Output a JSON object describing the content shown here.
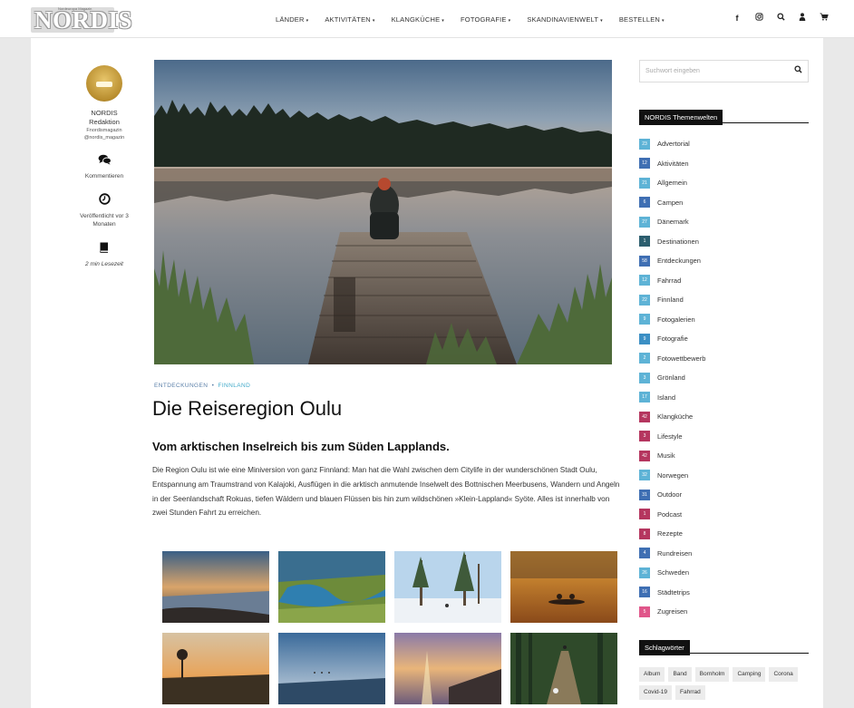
{
  "header": {
    "logo_text": "NORDIS",
    "logo_tagline": "Nordeuropa Magazin",
    "nav": [
      {
        "label": "LÄNDER"
      },
      {
        "label": "AKTIVITÄTEN"
      },
      {
        "label": "KLANGKÜCHE"
      },
      {
        "label": "FOTOGRAFIE"
      },
      {
        "label": "SKANDINAVIENWELT"
      },
      {
        "label": "BESTELLEN"
      }
    ],
    "icons": {
      "facebook": "f",
      "instagram": "◎",
      "search": "⚲",
      "user": "♟",
      "cart": "🛒"
    }
  },
  "author": {
    "name_line1": "NORDIS",
    "name_line2": "Redaktion",
    "sub1": "Fnordismagazin",
    "sub2": "@nordis_magazin",
    "comment_label": "Kommentieren",
    "published_label": "Veröffentlicht vor 3 Monaten",
    "read_label": "2 min Lesezeit"
  },
  "article": {
    "category_1": "ENTDECKUNGEN",
    "category_sep": "•",
    "category_2": "FINNLAND",
    "title": "Die Reiseregion Oulu",
    "lead": "Vom arktischen Inselreich bis zum Süden Lapplands.",
    "body": "Die Region Oulu ist wie eine Miniversion von ganz Finnland: Man hat die Wahl zwischen dem Citylife in der wunderschönen Stadt Oulu, Entspannung am Traumstrand von Kalajoki, Ausflügen in die arktisch anmutende Inselwelt des Bottnischen Meerbusens, Wandern und Angeln in der Seenlandschaft Rokuas, tiefen Wäldern und blauen Flüssen bis hin zum wildschönen »Klein-Lappland« Syöte. Alles ist innerhalb von zwei Stunden Fahrt zu erreichen."
  },
  "sidebar": {
    "search_placeholder": "Suchwort eingeben",
    "categories_title": "NORDIS Themenwelten",
    "categories": [
      {
        "count": "23",
        "name": "Advertorial",
        "color": "#5eb3d6"
      },
      {
        "count": "12",
        "name": "Aktivitäten",
        "color": "#3f6fb3"
      },
      {
        "count": "21",
        "name": "Allgemein",
        "color": "#5eb3d6"
      },
      {
        "count": "6",
        "name": "Campen",
        "color": "#3f6fb3"
      },
      {
        "count": "27",
        "name": "Dänemark",
        "color": "#5eb3d6"
      },
      {
        "count": "1",
        "name": "Destinationen",
        "color": "#2c5e6e"
      },
      {
        "count": "58",
        "name": "Entdeckungen",
        "color": "#3f6fb3"
      },
      {
        "count": "12",
        "name": "Fahrrad",
        "color": "#5eb3d6"
      },
      {
        "count": "22",
        "name": "Finnland",
        "color": "#5eb3d6"
      },
      {
        "count": "9",
        "name": "Fotogalerien",
        "color": "#5eb3d6"
      },
      {
        "count": "9",
        "name": "Fotografie",
        "color": "#3b8fc4"
      },
      {
        "count": "2",
        "name": "Fotowettbewerb",
        "color": "#5eb3d6"
      },
      {
        "count": "3",
        "name": "Grönland",
        "color": "#5eb3d6"
      },
      {
        "count": "17",
        "name": "Island",
        "color": "#5eb3d6"
      },
      {
        "count": "42",
        "name": "Klangküche",
        "color": "#b5365f"
      },
      {
        "count": "3",
        "name": "Lifestyle",
        "color": "#b5365f"
      },
      {
        "count": "42",
        "name": "Musik",
        "color": "#b5365f"
      },
      {
        "count": "32",
        "name": "Norwegen",
        "color": "#5eb3d6"
      },
      {
        "count": "31",
        "name": "Outdoor",
        "color": "#3f6fb3"
      },
      {
        "count": "1",
        "name": "Podcast",
        "color": "#b5365f"
      },
      {
        "count": "8",
        "name": "Rezepte",
        "color": "#b5365f"
      },
      {
        "count": "4",
        "name": "Rundreisen",
        "color": "#3f6fb3"
      },
      {
        "count": "26",
        "name": "Schweden",
        "color": "#5eb3d6"
      },
      {
        "count": "16",
        "name": "Städtetrips",
        "color": "#3f6fb3"
      },
      {
        "count": "5",
        "name": "Zugreisen",
        "color": "#e0568a"
      }
    ],
    "tags_title": "Schlagwörter",
    "tags": [
      "Album",
      "Band",
      "Bornholm",
      "Camping",
      "Corona",
      "Covid-19",
      "Fahrrad"
    ]
  }
}
